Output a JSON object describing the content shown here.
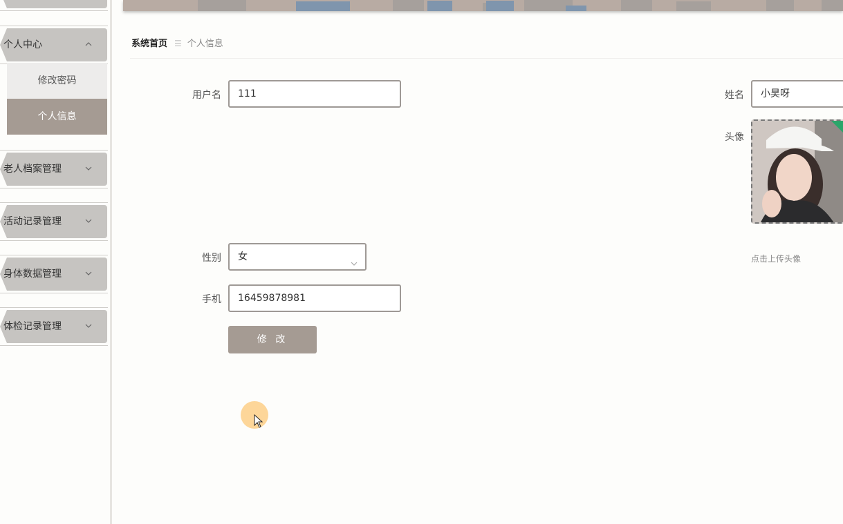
{
  "sidebar": {
    "groups": [
      {
        "label": "个人中心",
        "expanded": true
      },
      {
        "label": "老人档案管理",
        "expanded": false
      },
      {
        "label": "活动记录管理",
        "expanded": false
      },
      {
        "label": "身体数据管理",
        "expanded": false
      },
      {
        "label": "体检记录管理",
        "expanded": false
      }
    ],
    "subitems": [
      {
        "label": "修改密码",
        "active": false
      },
      {
        "label": "个人信息",
        "active": true
      }
    ]
  },
  "breadcrumb": {
    "home": "系统首页",
    "separator": "☰",
    "current": "个人信息"
  },
  "form": {
    "username": {
      "label": "用户名",
      "value": "111"
    },
    "name": {
      "label": "姓名",
      "value": "小昊呀"
    },
    "avatar": {
      "label": "头像",
      "tip": "点击上传头像"
    },
    "gender": {
      "label": "性别",
      "value": "女"
    },
    "phone": {
      "label": "手机",
      "value": "16459878981"
    },
    "submit_label": "修 改"
  },
  "colors": {
    "accent": "#a59b93",
    "menu_bg": "#c6c4c1",
    "banner": "#b8aba3"
  }
}
